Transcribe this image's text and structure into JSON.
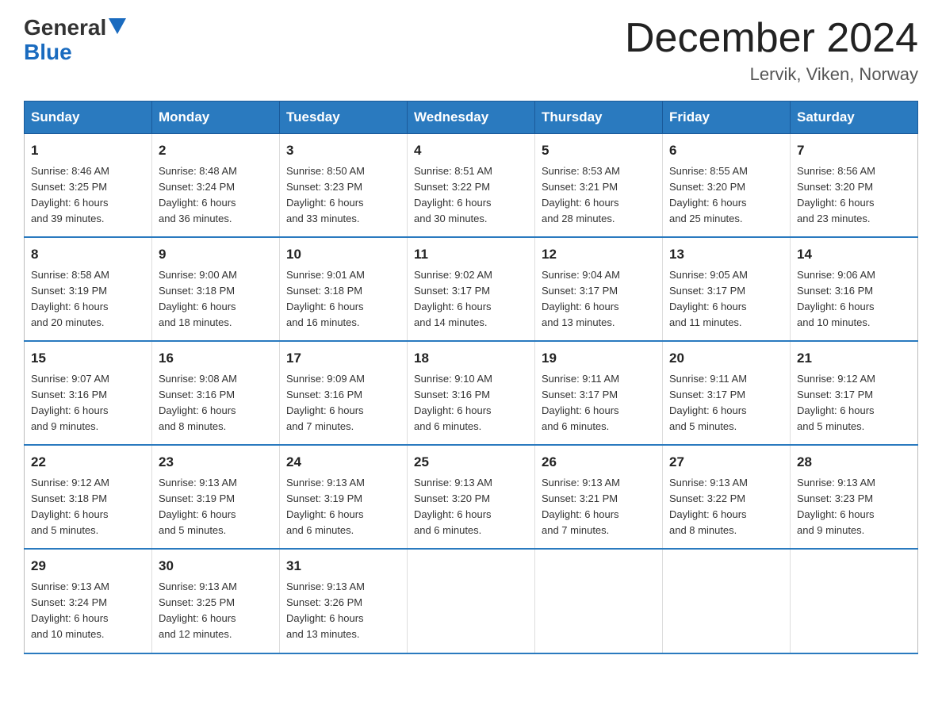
{
  "header": {
    "logo_general": "General",
    "logo_blue": "Blue",
    "month_title": "December 2024",
    "location": "Lervik, Viken, Norway"
  },
  "days_of_week": [
    "Sunday",
    "Monday",
    "Tuesday",
    "Wednesday",
    "Thursday",
    "Friday",
    "Saturday"
  ],
  "weeks": [
    [
      {
        "day": "1",
        "sunrise": "8:46 AM",
        "sunset": "3:25 PM",
        "daylight": "6 hours and 39 minutes."
      },
      {
        "day": "2",
        "sunrise": "8:48 AM",
        "sunset": "3:24 PM",
        "daylight": "6 hours and 36 minutes."
      },
      {
        "day": "3",
        "sunrise": "8:50 AM",
        "sunset": "3:23 PM",
        "daylight": "6 hours and 33 minutes."
      },
      {
        "day": "4",
        "sunrise": "8:51 AM",
        "sunset": "3:22 PM",
        "daylight": "6 hours and 30 minutes."
      },
      {
        "day": "5",
        "sunrise": "8:53 AM",
        "sunset": "3:21 PM",
        "daylight": "6 hours and 28 minutes."
      },
      {
        "day": "6",
        "sunrise": "8:55 AM",
        "sunset": "3:20 PM",
        "daylight": "6 hours and 25 minutes."
      },
      {
        "day": "7",
        "sunrise": "8:56 AM",
        "sunset": "3:20 PM",
        "daylight": "6 hours and 23 minutes."
      }
    ],
    [
      {
        "day": "8",
        "sunrise": "8:58 AM",
        "sunset": "3:19 PM",
        "daylight": "6 hours and 20 minutes."
      },
      {
        "day": "9",
        "sunrise": "9:00 AM",
        "sunset": "3:18 PM",
        "daylight": "6 hours and 18 minutes."
      },
      {
        "day": "10",
        "sunrise": "9:01 AM",
        "sunset": "3:18 PM",
        "daylight": "6 hours and 16 minutes."
      },
      {
        "day": "11",
        "sunrise": "9:02 AM",
        "sunset": "3:17 PM",
        "daylight": "6 hours and 14 minutes."
      },
      {
        "day": "12",
        "sunrise": "9:04 AM",
        "sunset": "3:17 PM",
        "daylight": "6 hours and 13 minutes."
      },
      {
        "day": "13",
        "sunrise": "9:05 AM",
        "sunset": "3:17 PM",
        "daylight": "6 hours and 11 minutes."
      },
      {
        "day": "14",
        "sunrise": "9:06 AM",
        "sunset": "3:16 PM",
        "daylight": "6 hours and 10 minutes."
      }
    ],
    [
      {
        "day": "15",
        "sunrise": "9:07 AM",
        "sunset": "3:16 PM",
        "daylight": "6 hours and 9 minutes."
      },
      {
        "day": "16",
        "sunrise": "9:08 AM",
        "sunset": "3:16 PM",
        "daylight": "6 hours and 8 minutes."
      },
      {
        "day": "17",
        "sunrise": "9:09 AM",
        "sunset": "3:16 PM",
        "daylight": "6 hours and 7 minutes."
      },
      {
        "day": "18",
        "sunrise": "9:10 AM",
        "sunset": "3:16 PM",
        "daylight": "6 hours and 6 minutes."
      },
      {
        "day": "19",
        "sunrise": "9:11 AM",
        "sunset": "3:17 PM",
        "daylight": "6 hours and 6 minutes."
      },
      {
        "day": "20",
        "sunrise": "9:11 AM",
        "sunset": "3:17 PM",
        "daylight": "6 hours and 5 minutes."
      },
      {
        "day": "21",
        "sunrise": "9:12 AM",
        "sunset": "3:17 PM",
        "daylight": "6 hours and 5 minutes."
      }
    ],
    [
      {
        "day": "22",
        "sunrise": "9:12 AM",
        "sunset": "3:18 PM",
        "daylight": "6 hours and 5 minutes."
      },
      {
        "day": "23",
        "sunrise": "9:13 AM",
        "sunset": "3:19 PM",
        "daylight": "6 hours and 5 minutes."
      },
      {
        "day": "24",
        "sunrise": "9:13 AM",
        "sunset": "3:19 PM",
        "daylight": "6 hours and 6 minutes."
      },
      {
        "day": "25",
        "sunrise": "9:13 AM",
        "sunset": "3:20 PM",
        "daylight": "6 hours and 6 minutes."
      },
      {
        "day": "26",
        "sunrise": "9:13 AM",
        "sunset": "3:21 PM",
        "daylight": "6 hours and 7 minutes."
      },
      {
        "day": "27",
        "sunrise": "9:13 AM",
        "sunset": "3:22 PM",
        "daylight": "6 hours and 8 minutes."
      },
      {
        "day": "28",
        "sunrise": "9:13 AM",
        "sunset": "3:23 PM",
        "daylight": "6 hours and 9 minutes."
      }
    ],
    [
      {
        "day": "29",
        "sunrise": "9:13 AM",
        "sunset": "3:24 PM",
        "daylight": "6 hours and 10 minutes."
      },
      {
        "day": "30",
        "sunrise": "9:13 AM",
        "sunset": "3:25 PM",
        "daylight": "6 hours and 12 minutes."
      },
      {
        "day": "31",
        "sunrise": "9:13 AM",
        "sunset": "3:26 PM",
        "daylight": "6 hours and 13 minutes."
      },
      null,
      null,
      null,
      null
    ]
  ]
}
